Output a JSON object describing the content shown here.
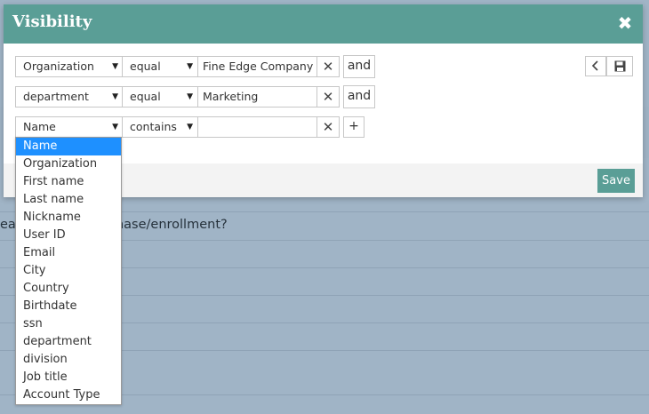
{
  "modal": {
    "title": "Visibility",
    "close_glyph": "✖",
    "save_label": "Save"
  },
  "rows": [
    {
      "field": "Organization",
      "operator": "equal",
      "value": "Fine Edge Company",
      "clear": "✕",
      "conj": "and"
    },
    {
      "field": "department",
      "operator": "equal",
      "value": "Marketing",
      "clear": "✕",
      "conj": "and"
    },
    {
      "field": "Name",
      "operator": "contains",
      "value": "",
      "clear": "✕",
      "add": "+"
    }
  ],
  "tools": {
    "back_icon": "chevron-left-icon",
    "save_icon": "floppy-disk-icon"
  },
  "dropdown": {
    "options": [
      "Name",
      "Organization",
      "First name",
      "Last name",
      "Nickname",
      "User ID",
      "Email",
      "City",
      "Country",
      "Birthdate",
      "ssn",
      "department",
      "division",
      "Job title",
      "Account Type"
    ],
    "selected": "Name"
  },
  "background": {
    "text_fragment_left": "ea",
    "text_fragment_right": "chase/enrollment?"
  },
  "colors": {
    "header": "#5a9e96",
    "save_button": "#5a9e96",
    "dropdown_selected": "#1e90ff",
    "backdrop": "#a0b4c6"
  }
}
